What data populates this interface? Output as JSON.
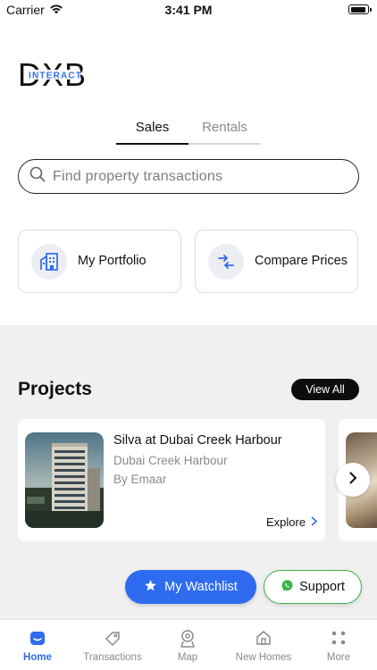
{
  "status_bar": {
    "carrier": "Carrier",
    "time": "3:41 PM"
  },
  "logo": {
    "text": "DXB",
    "sub": "INTERACT",
    "accent_color": "#2f6bef"
  },
  "tabs": [
    {
      "label": "Sales",
      "active": true
    },
    {
      "label": "Rentals",
      "active": false
    }
  ],
  "search": {
    "placeholder": "Find property transactions",
    "value": ""
  },
  "quick_actions": [
    {
      "label": "My Portfolio",
      "icon": "building-icon"
    },
    {
      "label": "Compare Prices",
      "icon": "compare-arrows-icon"
    }
  ],
  "projects": {
    "title": "Projects",
    "view_all_label": "View All",
    "cards": [
      {
        "name": "Silva at Dubai Creek Harbour",
        "area": "Dubai Creek Harbour",
        "developer": "By Emaar",
        "explore_label": "Explore"
      }
    ]
  },
  "floating": {
    "watchlist_label": "My Watchlist",
    "support_label": "Support"
  },
  "bottom_nav": [
    {
      "label": "Home",
      "icon": "home-icon",
      "active": true
    },
    {
      "label": "Transactions",
      "icon": "tag-icon",
      "active": false
    },
    {
      "label": "Map",
      "icon": "map-pin-icon",
      "active": false
    },
    {
      "label": "New Homes",
      "icon": "house-icon",
      "active": false
    },
    {
      "label": "More",
      "icon": "grid-dots-icon",
      "active": false
    }
  ],
  "colors": {
    "primary": "#2f6bef",
    "support_green": "#3bb54a",
    "background": "#f0f0f0"
  }
}
